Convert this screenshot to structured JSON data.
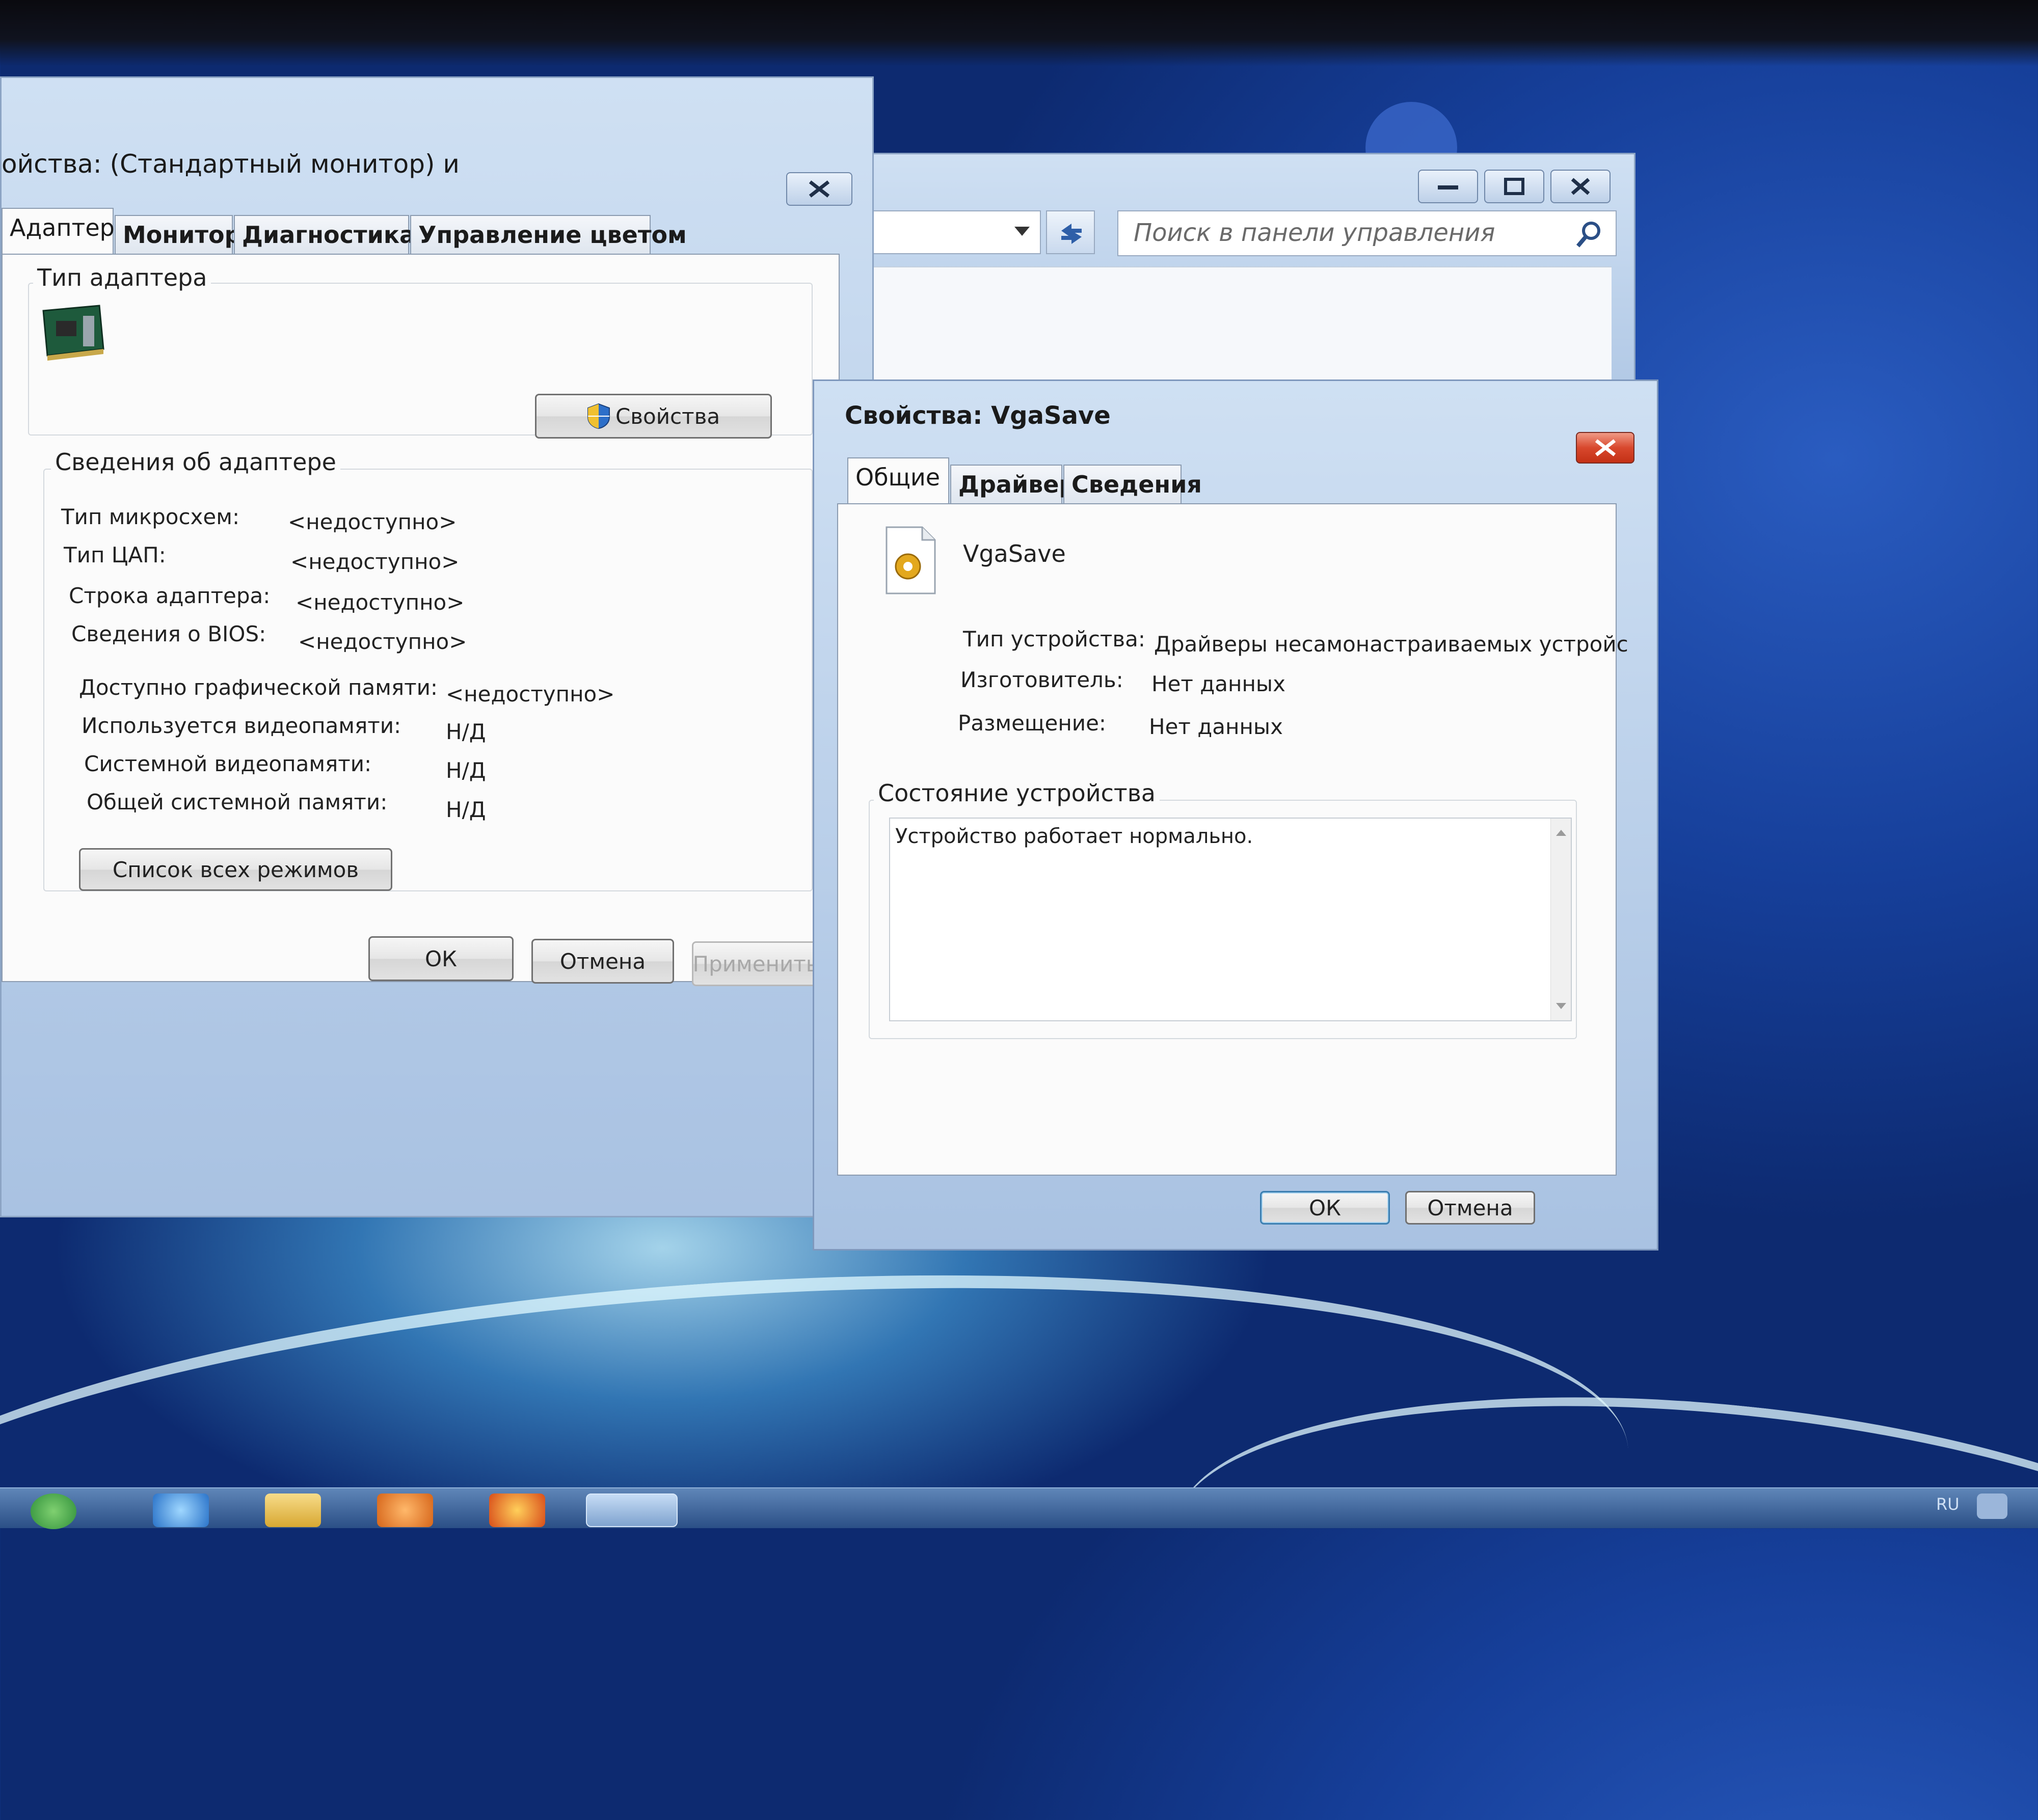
{
  "adapter_window": {
    "title": "ойства: (Стандартный монитор) и",
    "tabs": [
      "Адаптер",
      "Монитор",
      "Диагностика",
      "Управление цветом"
    ],
    "adapter_type_group": "Тип адаптера",
    "properties_button": "Свойства",
    "adapter_info_group": "Сведения об адаптере",
    "fields": [
      {
        "label": "Тип микросхем:",
        "value": "<недоступно>"
      },
      {
        "label": "Тип ЦАП:",
        "value": "<недоступно>"
      },
      {
        "label": "Строка адаптера:",
        "value": "<недоступно>"
      },
      {
        "label": "Сведения о BIOS:",
        "value": "<недоступно>"
      }
    ],
    "memory_fields": [
      {
        "label": "Доступно графической памяти:",
        "value": "<недоступно>"
      },
      {
        "label": "Используется видеопамяти:",
        "value": "Н/Д"
      },
      {
        "label": "Системной видеопамяти:",
        "value": "Н/Д"
      },
      {
        "label": "Общей системной памяти:",
        "value": "Н/Д"
      }
    ],
    "list_modes_button": "Список всех режимов",
    "ok_button": "ОК",
    "cancel_button": "Отмена",
    "apply_button": "Применить"
  },
  "control_panel": {
    "search_placeholder": "Поиск в панели управления"
  },
  "vgasave_window": {
    "title": "Свойства: VgaSave",
    "tabs": [
      "Общие",
      "Драйвер",
      "Сведения"
    ],
    "device_name": "VgaSave",
    "fields": [
      {
        "label": "Тип устройства:",
        "value": "Драйверы несамонастраиваемых устройс"
      },
      {
        "label": "Изготовитель:",
        "value": "Нет данных"
      },
      {
        "label": "Размещение:",
        "value": "Нет данных"
      }
    ],
    "status_group": "Состояние устройства",
    "status_text": "Устройство работает нормально.",
    "ok_button": "ОК",
    "cancel_button": "Отмена"
  },
  "taskbar": {
    "language": "RU"
  }
}
